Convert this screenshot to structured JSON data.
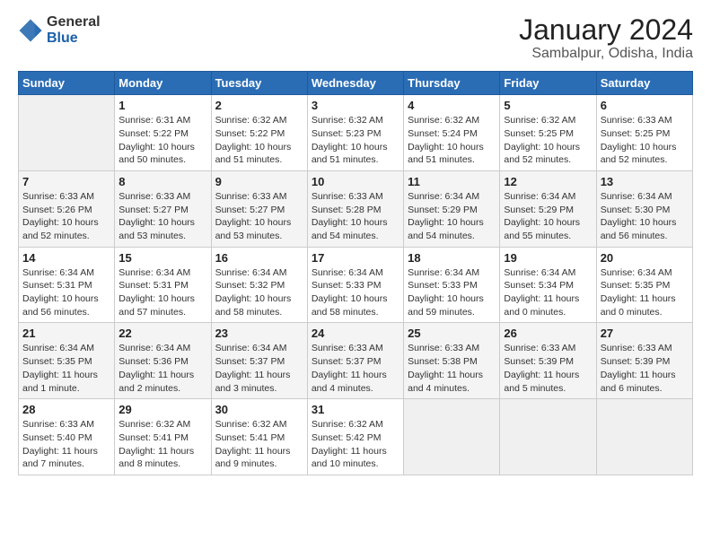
{
  "logo": {
    "general": "General",
    "blue": "Blue"
  },
  "title": "January 2024",
  "subtitle": "Sambalpur, Odisha, India",
  "weekdays": [
    "Sunday",
    "Monday",
    "Tuesday",
    "Wednesday",
    "Thursday",
    "Friday",
    "Saturday"
  ],
  "weeks": [
    [
      {
        "day": "",
        "info": ""
      },
      {
        "day": "1",
        "info": "Sunrise: 6:31 AM\nSunset: 5:22 PM\nDaylight: 10 hours\nand 50 minutes."
      },
      {
        "day": "2",
        "info": "Sunrise: 6:32 AM\nSunset: 5:22 PM\nDaylight: 10 hours\nand 51 minutes."
      },
      {
        "day": "3",
        "info": "Sunrise: 6:32 AM\nSunset: 5:23 PM\nDaylight: 10 hours\nand 51 minutes."
      },
      {
        "day": "4",
        "info": "Sunrise: 6:32 AM\nSunset: 5:24 PM\nDaylight: 10 hours\nand 51 minutes."
      },
      {
        "day": "5",
        "info": "Sunrise: 6:32 AM\nSunset: 5:25 PM\nDaylight: 10 hours\nand 52 minutes."
      },
      {
        "day": "6",
        "info": "Sunrise: 6:33 AM\nSunset: 5:25 PM\nDaylight: 10 hours\nand 52 minutes."
      }
    ],
    [
      {
        "day": "7",
        "info": "Sunrise: 6:33 AM\nSunset: 5:26 PM\nDaylight: 10 hours\nand 52 minutes."
      },
      {
        "day": "8",
        "info": "Sunrise: 6:33 AM\nSunset: 5:27 PM\nDaylight: 10 hours\nand 53 minutes."
      },
      {
        "day": "9",
        "info": "Sunrise: 6:33 AM\nSunset: 5:27 PM\nDaylight: 10 hours\nand 53 minutes."
      },
      {
        "day": "10",
        "info": "Sunrise: 6:33 AM\nSunset: 5:28 PM\nDaylight: 10 hours\nand 54 minutes."
      },
      {
        "day": "11",
        "info": "Sunrise: 6:34 AM\nSunset: 5:29 PM\nDaylight: 10 hours\nand 54 minutes."
      },
      {
        "day": "12",
        "info": "Sunrise: 6:34 AM\nSunset: 5:29 PM\nDaylight: 10 hours\nand 55 minutes."
      },
      {
        "day": "13",
        "info": "Sunrise: 6:34 AM\nSunset: 5:30 PM\nDaylight: 10 hours\nand 56 minutes."
      }
    ],
    [
      {
        "day": "14",
        "info": "Sunrise: 6:34 AM\nSunset: 5:31 PM\nDaylight: 10 hours\nand 56 minutes."
      },
      {
        "day": "15",
        "info": "Sunrise: 6:34 AM\nSunset: 5:31 PM\nDaylight: 10 hours\nand 57 minutes."
      },
      {
        "day": "16",
        "info": "Sunrise: 6:34 AM\nSunset: 5:32 PM\nDaylight: 10 hours\nand 58 minutes."
      },
      {
        "day": "17",
        "info": "Sunrise: 6:34 AM\nSunset: 5:33 PM\nDaylight: 10 hours\nand 58 minutes."
      },
      {
        "day": "18",
        "info": "Sunrise: 6:34 AM\nSunset: 5:33 PM\nDaylight: 10 hours\nand 59 minutes."
      },
      {
        "day": "19",
        "info": "Sunrise: 6:34 AM\nSunset: 5:34 PM\nDaylight: 11 hours\nand 0 minutes."
      },
      {
        "day": "20",
        "info": "Sunrise: 6:34 AM\nSunset: 5:35 PM\nDaylight: 11 hours\nand 0 minutes."
      }
    ],
    [
      {
        "day": "21",
        "info": "Sunrise: 6:34 AM\nSunset: 5:35 PM\nDaylight: 11 hours\nand 1 minute."
      },
      {
        "day": "22",
        "info": "Sunrise: 6:34 AM\nSunset: 5:36 PM\nDaylight: 11 hours\nand 2 minutes."
      },
      {
        "day": "23",
        "info": "Sunrise: 6:34 AM\nSunset: 5:37 PM\nDaylight: 11 hours\nand 3 minutes."
      },
      {
        "day": "24",
        "info": "Sunrise: 6:33 AM\nSunset: 5:37 PM\nDaylight: 11 hours\nand 4 minutes."
      },
      {
        "day": "25",
        "info": "Sunrise: 6:33 AM\nSunset: 5:38 PM\nDaylight: 11 hours\nand 4 minutes."
      },
      {
        "day": "26",
        "info": "Sunrise: 6:33 AM\nSunset: 5:39 PM\nDaylight: 11 hours\nand 5 minutes."
      },
      {
        "day": "27",
        "info": "Sunrise: 6:33 AM\nSunset: 5:39 PM\nDaylight: 11 hours\nand 6 minutes."
      }
    ],
    [
      {
        "day": "28",
        "info": "Sunrise: 6:33 AM\nSunset: 5:40 PM\nDaylight: 11 hours\nand 7 minutes."
      },
      {
        "day": "29",
        "info": "Sunrise: 6:32 AM\nSunset: 5:41 PM\nDaylight: 11 hours\nand 8 minutes."
      },
      {
        "day": "30",
        "info": "Sunrise: 6:32 AM\nSunset: 5:41 PM\nDaylight: 11 hours\nand 9 minutes."
      },
      {
        "day": "31",
        "info": "Sunrise: 6:32 AM\nSunset: 5:42 PM\nDaylight: 11 hours\nand 10 minutes."
      },
      {
        "day": "",
        "info": ""
      },
      {
        "day": "",
        "info": ""
      },
      {
        "day": "",
        "info": ""
      }
    ]
  ]
}
